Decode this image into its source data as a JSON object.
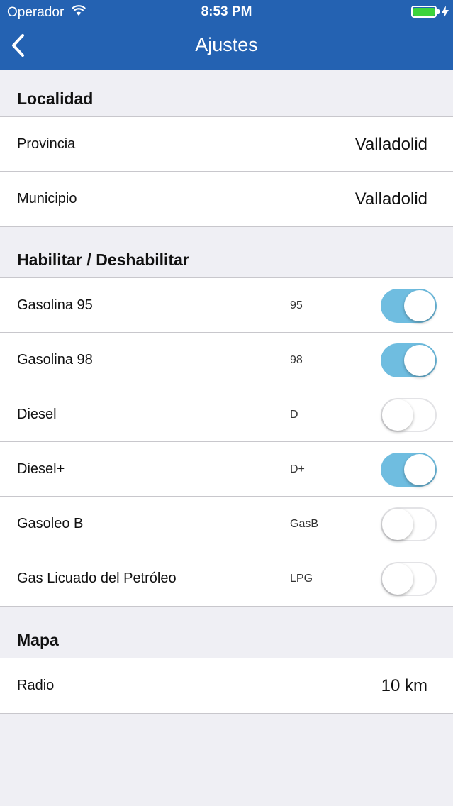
{
  "status_bar": {
    "carrier": "Operador",
    "time": "8:53 PM",
    "battery_color": "#3cd33c"
  },
  "nav": {
    "title": "Ajustes",
    "back_icon": "chevron-left-icon",
    "bar_color": "#2462b2"
  },
  "sections": {
    "location": {
      "header": "Localidad",
      "rows": [
        {
          "label": "Provincia",
          "value": "Valladolid"
        },
        {
          "label": "Municipio",
          "value": "Valladolid"
        }
      ]
    },
    "fuels": {
      "header": "Habilitar / Deshabilitar",
      "rows": [
        {
          "label": "Gasolina 95",
          "code": "95",
          "enabled": true
        },
        {
          "label": "Gasolina 98",
          "code": "98",
          "enabled": true
        },
        {
          "label": "Diesel",
          "code": "D",
          "enabled": false
        },
        {
          "label": "Diesel+",
          "code": "D+",
          "enabled": true
        },
        {
          "label": "Gasoleo B",
          "code": "GasB",
          "enabled": false
        },
        {
          "label": "Gas Licuado del Petróleo",
          "code": "LPG",
          "enabled": false
        }
      ],
      "toggle_on_color": "#6fbde0"
    },
    "map": {
      "header": "Mapa",
      "rows": [
        {
          "label": "Radio",
          "value": "10 km"
        }
      ]
    }
  }
}
